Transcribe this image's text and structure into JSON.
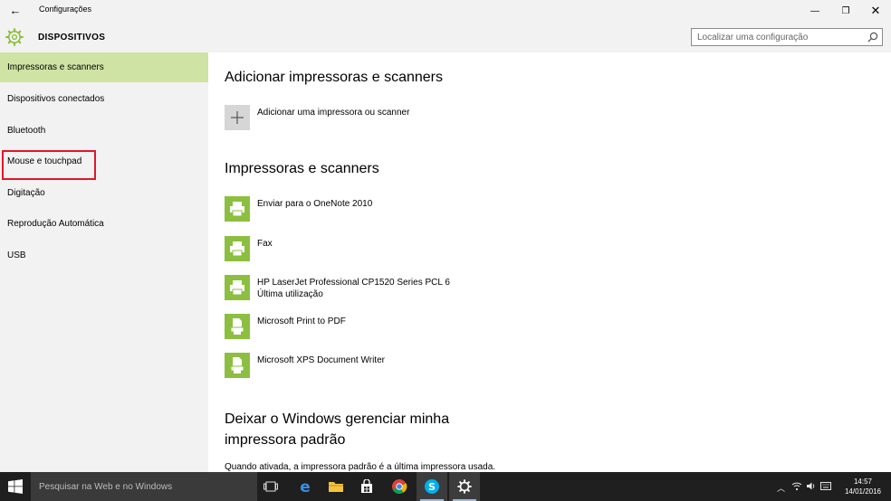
{
  "window": {
    "back_glyph": "←",
    "title": "Configurações",
    "minimize_glyph": "—",
    "maximize_glyph": "❐",
    "close_glyph": "✕"
  },
  "header": {
    "title": "DISPOSITIVOS",
    "search_placeholder": "Localizar uma configuração",
    "accent_color": "#8cbf40"
  },
  "sidebar": {
    "items": [
      {
        "label": "Impressoras e scanners",
        "active": true
      },
      {
        "label": "Dispositivos conectados"
      },
      {
        "label": "Bluetooth"
      },
      {
        "label": "Mouse e touchpad",
        "highlighted": true
      },
      {
        "label": "Digitação"
      },
      {
        "label": "Reprodução Automática"
      },
      {
        "label": "USB"
      }
    ],
    "active_color": "#cfe3a4",
    "highlight_color": "#e3152a"
  },
  "main": {
    "add_section_title": "Adicionar impressoras e scanners",
    "add_button_label": "Adicionar uma impressora ou scanner",
    "printers_section_title": "Impressoras e scanners",
    "devices": [
      {
        "name": "Enviar para o OneNote 2010",
        "icon": "printer-icon"
      },
      {
        "name": "Fax",
        "icon": "printer-icon"
      },
      {
        "name": "HP LaserJet Professional CP1520 Series PCL 6",
        "sub": "Última utilização",
        "icon": "printer-icon"
      },
      {
        "name": "Microsoft Print to PDF",
        "icon": "document-printer-icon"
      },
      {
        "name": "Microsoft XPS Document Writer",
        "icon": "document-printer-icon"
      }
    ],
    "default_section_title": "Deixar o Windows gerenciar minha impressora padrão",
    "default_description": "Quando ativada, a impressora padrão é a última impressora usada."
  },
  "taskbar": {
    "search_text": "Pesquisar na Web e no Windows",
    "apps": [
      "task-view-icon",
      "edge-icon",
      "file-explorer-icon",
      "store-icon",
      "chrome-icon",
      "skype-icon",
      "settings-icon"
    ],
    "clock_time": "14:57",
    "clock_date": "14/01/2016"
  }
}
